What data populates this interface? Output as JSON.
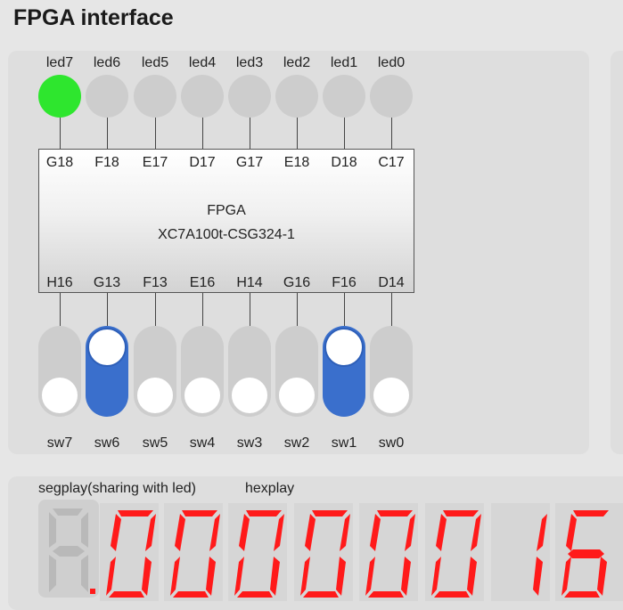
{
  "header": {
    "title": "FPGA interface"
  },
  "fpga": {
    "name": "FPGA",
    "part": "XC7A100t-CSG324-1"
  },
  "leds": [
    {
      "label": "led7",
      "pin": "G18",
      "on": true
    },
    {
      "label": "led6",
      "pin": "F18",
      "on": false
    },
    {
      "label": "led5",
      "pin": "E17",
      "on": false
    },
    {
      "label": "led4",
      "pin": "D17",
      "on": false
    },
    {
      "label": "led3",
      "pin": "G17",
      "on": false
    },
    {
      "label": "led2",
      "pin": "E18",
      "on": false
    },
    {
      "label": "led1",
      "pin": "D18",
      "on": false
    },
    {
      "label": "led0",
      "pin": "C17",
      "on": false
    }
  ],
  "switches": [
    {
      "label": "sw7",
      "pin": "H16",
      "on": false
    },
    {
      "label": "sw6",
      "pin": "G13",
      "on": true
    },
    {
      "label": "sw5",
      "pin": "F13",
      "on": false
    },
    {
      "label": "sw4",
      "pin": "E16",
      "on": false
    },
    {
      "label": "sw3",
      "pin": "H14",
      "on": false
    },
    {
      "label": "sw2",
      "pin": "G16",
      "on": false
    },
    {
      "label": "sw1",
      "pin": "F16",
      "on": true
    },
    {
      "label": "sw0",
      "pin": "D14",
      "on": false
    }
  ],
  "display": {
    "segplay_label": "segplay(sharing with led)",
    "hexplay_label": "hexplay",
    "digits": [
      "0",
      "0",
      "0",
      "0",
      "0",
      "0",
      "1",
      "6"
    ]
  },
  "colors": {
    "led_on": "#2ee62e",
    "led_off": "#cdcdcd",
    "switch_on": "#3a6fcc",
    "switch_off": "#cdcdcd",
    "segment_on": "#ff1a1a"
  }
}
